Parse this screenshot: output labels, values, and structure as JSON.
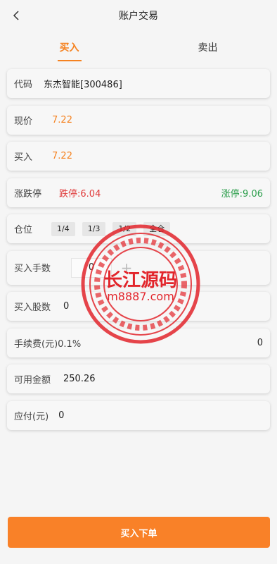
{
  "header": {
    "title": "账户交易"
  },
  "tabs": [
    {
      "label": "买入"
    },
    {
      "label": "卖出"
    }
  ],
  "form": {
    "code": {
      "label": "代码",
      "value": "东杰智能[300486]"
    },
    "current_price": {
      "label": "现价",
      "value": "7.22"
    },
    "buy_price": {
      "label": "买入",
      "value": "7.22"
    },
    "limits": {
      "label": "涨跌停",
      "down": "跌停:6.04",
      "up": "涨停:9.06"
    },
    "position": {
      "label": "仓位",
      "options": [
        "1/4",
        "1/3",
        "1/2",
        "全仓"
      ]
    },
    "lots": {
      "label": "买入手数",
      "value": "0"
    },
    "shares": {
      "label": "买入股数",
      "value": "0"
    },
    "fee": {
      "label": "手续费(元)0.1%",
      "value": "0"
    },
    "available": {
      "label": "可用金额",
      "value": "250.26"
    },
    "payable": {
      "label": "应付(元)",
      "value": "0"
    }
  },
  "submit_label": "买入下单",
  "watermark": {
    "title": "长江源码",
    "subtitle": "m8887.com"
  },
  "colors": {
    "accent": "#f58220",
    "limit_down": "#e03a3a",
    "limit_up": "#2a9d4a",
    "button": "#f98128",
    "watermark": "#e2252b"
  }
}
